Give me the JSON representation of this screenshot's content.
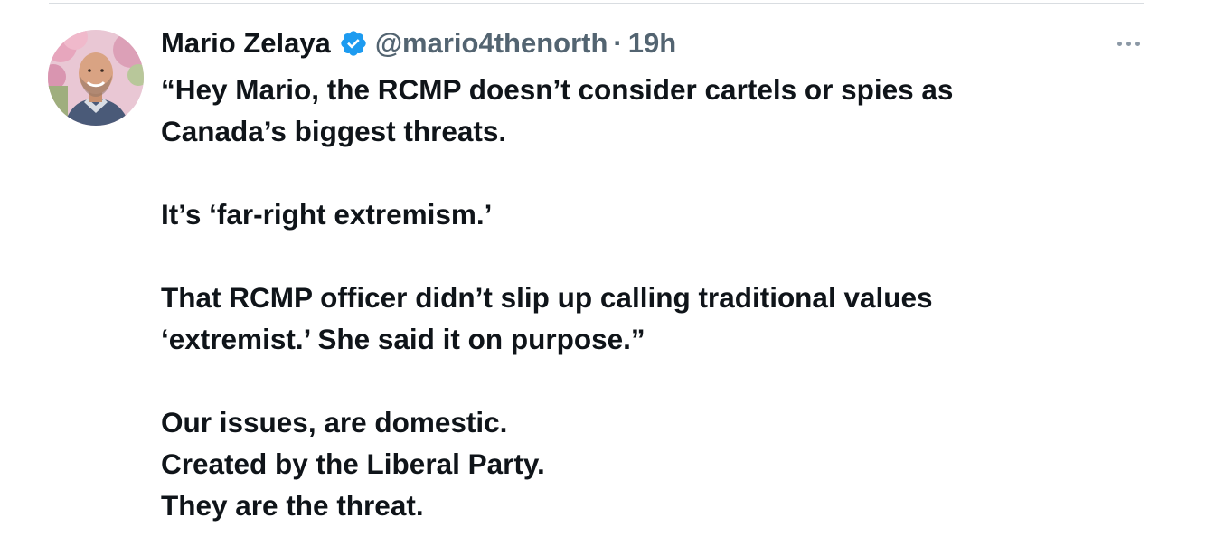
{
  "tweet": {
    "author": {
      "display_name": "Mario Zelaya",
      "handle": "@mario4thenorth",
      "verified": true,
      "verified_icon": "verified-badge-icon",
      "avatar_icon": "avatar"
    },
    "separator": "·",
    "timestamp": "19h",
    "more_icon": "more-options-icon",
    "lines": [
      "“Hey Mario, the RCMP doesn’t consider cartels or spies as",
      "Canada’s biggest threats.",
      "",
      "It’s ‘far-right extremism.’",
      "",
      "That RCMP officer didn’t slip up calling traditional values",
      "‘extremist.’ She said it on purpose.”",
      "",
      "Our issues, are domestic.",
      "Created by the Liberal Party.",
      "They are the threat."
    ]
  },
  "colors": {
    "text_primary": "#0f1419",
    "text_secondary": "#536471",
    "verified_blue": "#1d9bf0",
    "divider": "#d9dde1"
  }
}
